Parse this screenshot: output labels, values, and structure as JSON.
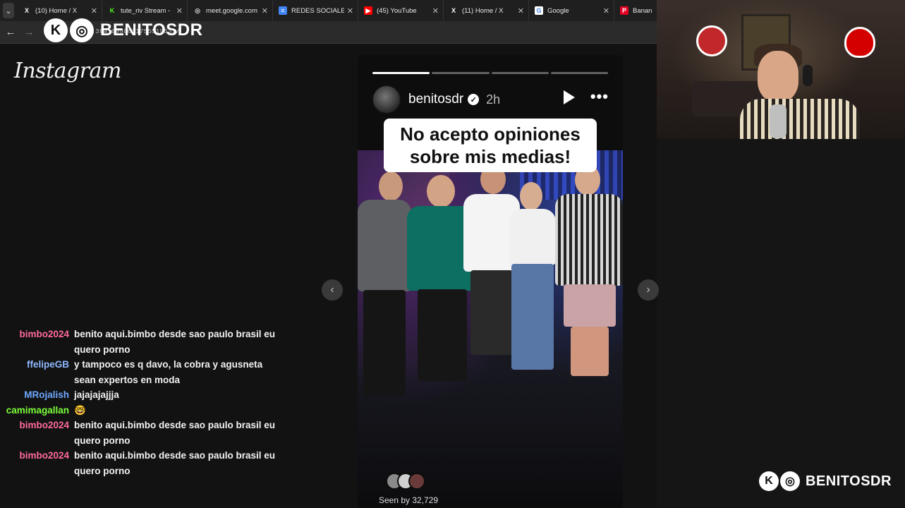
{
  "browser": {
    "tabs": [
      {
        "icon": "x-icon",
        "label": "(10) Home / X",
        "icon_char": "X",
        "icon_color": "#ffffff",
        "icon_bg": "transparent"
      },
      {
        "icon": "kick-icon",
        "label": "tute_riv Stream - ",
        "icon_char": "K",
        "icon_color": "#53fc18",
        "icon_bg": "transparent"
      },
      {
        "icon": "globe-icon",
        "label": "meet.google.com",
        "icon_char": "◎",
        "icon_color": "#cfcfcf",
        "icon_bg": "transparent"
      },
      {
        "icon": "docs-icon",
        "label": "REDES SOCIALES",
        "icon_char": "≡",
        "icon_color": "#ffffff",
        "icon_bg": "#4285f4"
      },
      {
        "icon": "youtube-icon",
        "label": "(45) YouTube",
        "icon_char": "▶",
        "icon_color": "#ffffff",
        "icon_bg": "#ff0000"
      },
      {
        "icon": "x-icon",
        "label": "(11) Home / X",
        "icon_char": "X",
        "icon_color": "#ffffff",
        "icon_bg": "transparent"
      },
      {
        "icon": "google-icon",
        "label": "Google",
        "icon_char": "G",
        "icon_color": "#4285f4",
        "icon_bg": "#ffffff"
      },
      {
        "icon": "pinterest-icon",
        "label": "Bananas",
        "icon_char": "P",
        "icon_color": "#ffffff",
        "icon_bg": "#e60023"
      }
    ],
    "tab_close": "✕",
    "menu_glyph": "⌄",
    "back": "←",
    "forward": "→",
    "url": "...3ta                                        0998631755519631/"
  },
  "brand": {
    "kick_glyph": "K",
    "ig_glyph": "◎",
    "name": "BENITOSDR"
  },
  "instagram": {
    "logo": "Instagram",
    "story": {
      "segments": [
        true,
        false,
        false,
        false
      ],
      "username": "benitosdr",
      "verified": "✓",
      "time": "2h",
      "more": "•••",
      "caption": "No acepto opiniones sobre mis medias!",
      "seen_by": "Seen by 32,729",
      "prev": "‹",
      "next": "›"
    }
  },
  "chat": [
    {
      "user": "bimbo2024",
      "color": "#ff6b9a",
      "text": "benito aqui.bimbo desde sao paulo brasil eu quero porno"
    },
    {
      "user": "ffelipeGB",
      "color": "#8fb8ff",
      "text": "y tampoco es q davo, la cobra y agusneta sean expertos en moda"
    },
    {
      "user": "MRojalish",
      "color": "#6fa8ff",
      "text": "jajajajajjja"
    },
    {
      "user": "camimagallan",
      "color": "#7cff3a",
      "text": "🤓"
    },
    {
      "user": "bimbo2024",
      "color": "#ff6b9a",
      "text": "benito aqui.bimbo desde sao paulo brasil eu quero porno"
    },
    {
      "user": "bimbo2024",
      "color": "#ff6b9a",
      "text": "benito aqui.bimbo desde sao paulo brasil eu quero porno"
    }
  ],
  "colors": {
    "page_bg": "#121212",
    "chrome_bg": "#1f1f1f",
    "river_red": "#d40000"
  }
}
